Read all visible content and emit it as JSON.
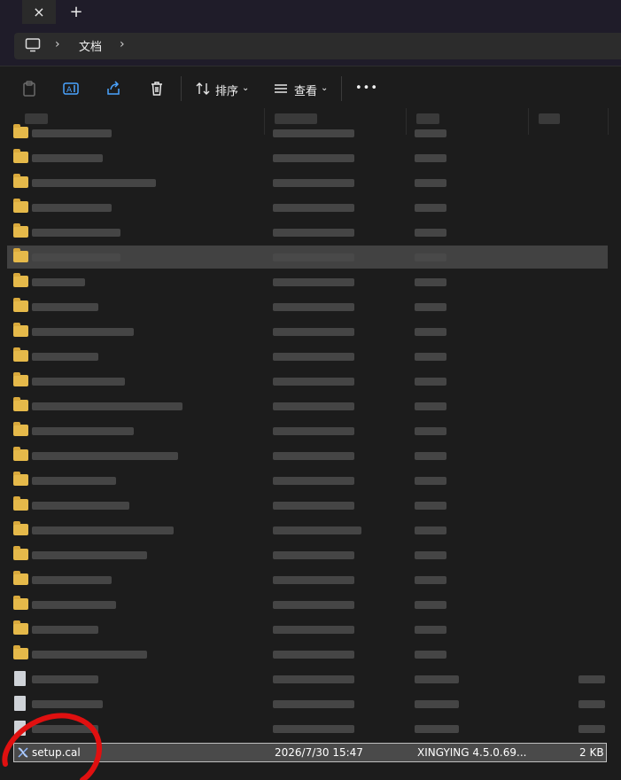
{
  "tab": {
    "close_glyph": "×",
    "new_glyph": "+"
  },
  "address": {
    "icon": "computer-icon",
    "crumb": "文档"
  },
  "toolbar": {
    "sort_label": "排序",
    "view_label": "查看",
    "more_label": "•••"
  },
  "selected_file": {
    "name": "setup.cal",
    "date": "2026/7/30 15:47",
    "type": "XINGYING 4.5.0.69...",
    "size": "2 KB",
    "icon": "xingying-file-icon"
  },
  "colors": {
    "accent_folder": "#e5b94a",
    "annotation": "#e01010",
    "selected_row": "#424242"
  }
}
